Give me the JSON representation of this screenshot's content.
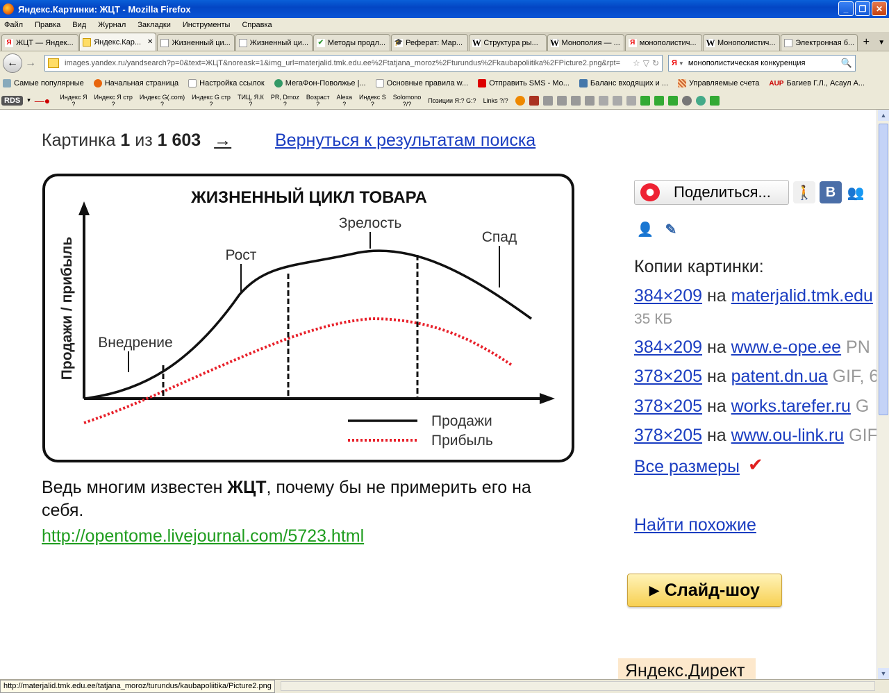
{
  "window": {
    "title": "Яндекс.Картинки: ЖЦТ - Mozilla Firefox"
  },
  "menu": [
    "Файл",
    "Правка",
    "Вид",
    "Журнал",
    "Закладки",
    "Инструменты",
    "Справка"
  ],
  "tabs": [
    {
      "label": "ЖЦТ — Яндек...",
      "icon": "yandex-icon"
    },
    {
      "label": "Яндекс.Кар...",
      "icon": "yandex-images-icon",
      "active": true
    },
    {
      "label": "Жизненный ци...",
      "icon": "page-icon"
    },
    {
      "label": "Жизненный ци...",
      "icon": "page-icon"
    },
    {
      "label": "Методы продл...",
      "icon": "check-icon"
    },
    {
      "label": "Реферат: Мар...",
      "icon": "graduation-cap-icon"
    },
    {
      "label": "Структура ры...",
      "icon": "wikipedia-icon"
    },
    {
      "label": "Монополия — ...",
      "icon": "wikipedia-icon"
    },
    {
      "label": "монополистич...",
      "icon": "yandex-icon"
    },
    {
      "label": "Монополистич...",
      "icon": "wikipedia-icon"
    },
    {
      "label": "Электронная б...",
      "icon": "page-icon"
    }
  ],
  "nav": {
    "url": "images.yandex.ru/yandsearch?p=0&text=ЖЦТ&noreask=1&img_url=materjalid.tmk.edu.ee%2Ftatjana_moroz%2Fturundus%2Fkaubapoliitika%2FPicture2.png&rpt=",
    "search": "монополистическая конкуренция"
  },
  "bookmarks": [
    "Самые популярные",
    "Начальная страница",
    "Настройка ссылок",
    "МегаФон-Поволжье |...",
    "Основные правила w...",
    "Отправить SMS - Мо...",
    "Баланс входящих и ...",
    "Управляемые счета",
    "Багиев Г.Л., Асаул А..."
  ],
  "seobar": {
    "logo": "RDS",
    "items": [
      "Индекс Я",
      "Индекс Я стр",
      "Индекс G(.com)",
      "Индекс G стр",
      "ТИЦ, Я.К",
      "PR, Dmoz",
      "Возраст",
      "Alexa",
      "Индекс S",
      "Solomono",
      "Позиции Я:? G:?",
      "Links ?/?"
    ],
    "subs": [
      "?",
      "?",
      "?",
      "?",
      "?",
      "?",
      "?",
      "?",
      "?",
      "?/?",
      "",
      ""
    ]
  },
  "content": {
    "pager": {
      "prefix": "Картинка",
      "current": "1",
      "of": "из",
      "total": "1 603",
      "arrow": "→"
    },
    "back_link": "Вернуться к результатам поиска",
    "description_pre": "Ведь многим известен ",
    "description_bold": "ЖЦТ",
    "description_post": ", почему бы не примерить его на себя.",
    "source_link": "http://opentome.livejournal.com/5723.html"
  },
  "chart": {
    "title": "ЖИЗНЕННЫЙ ЦИКЛ ТОВАРА",
    "ylabel": "Продажи / прибыль",
    "stages": [
      "Внедрение",
      "Рост",
      "Зрелость",
      "Спад"
    ],
    "legend": [
      "Продажи",
      "Прибыль"
    ],
    "colors": {
      "sales": "#111111",
      "profit": "#e8202a"
    }
  },
  "right": {
    "share": "Поделиться...",
    "copies_title": "Копии картинки:",
    "copies": [
      {
        "size": "384×209",
        "on": "на",
        "host": "materjalid.tmk.edu",
        "fmt": ""
      },
      {
        "size": "384×209",
        "on": "на",
        "host": "www.e-ope.ee",
        "fmt": "PN"
      },
      {
        "size": "378×205",
        "on": "на",
        "host": "patent.dn.ua",
        "fmt": "GIF, 6"
      },
      {
        "size": "378×205",
        "on": "на",
        "host": "works.tarefer.ru",
        "fmt": "G"
      },
      {
        "size": "378×205",
        "on": "на",
        "host": "www.ou-link.ru",
        "fmt": "GIF"
      }
    ],
    "first_copy_size": "35 КБ",
    "all_sizes": "Все размеры",
    "find_similar": "Найти похожие",
    "slideshow": "Слайд-шоу",
    "direct": "Яндекс.Директ"
  },
  "status": "http://materjalid.tmk.edu.ee/tatjana_moroz/turundus/kaubapoliitika/Picture2.png"
}
